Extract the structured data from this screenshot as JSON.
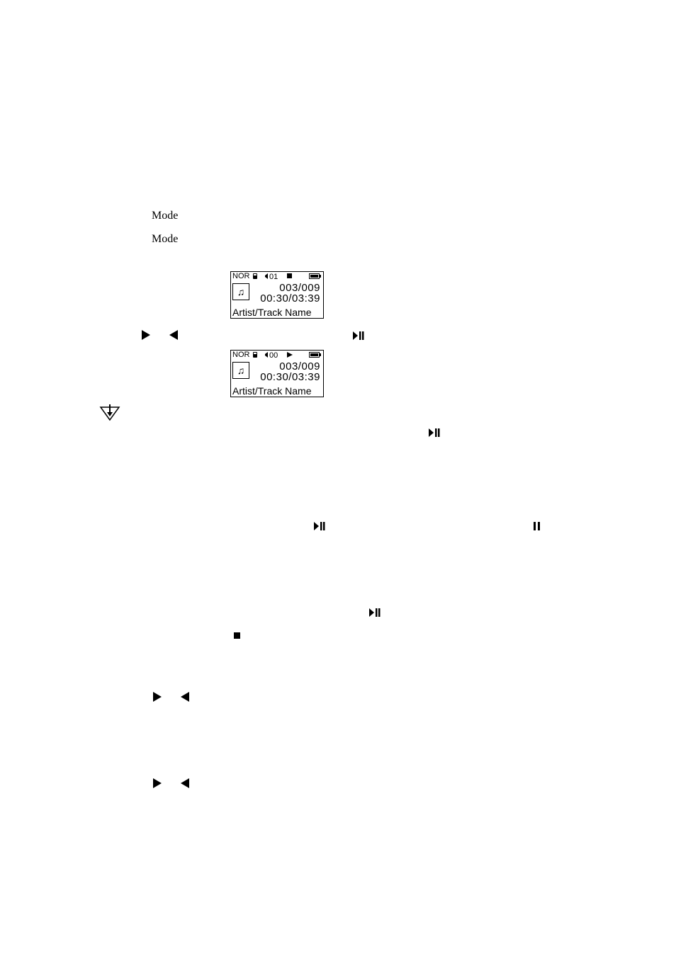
{
  "labels": {
    "mode1": "Mode",
    "mode2": "Mode"
  },
  "lcd1": {
    "nor": "NOR",
    "vol": "01",
    "track": "003/009",
    "time": "00:30/03:39",
    "name": "Artist/Track Name"
  },
  "lcd2": {
    "nor": "NOR",
    "vol": "00",
    "track": "003/009",
    "time": "00:30/03:39",
    "name": "Artist/Track Name"
  }
}
